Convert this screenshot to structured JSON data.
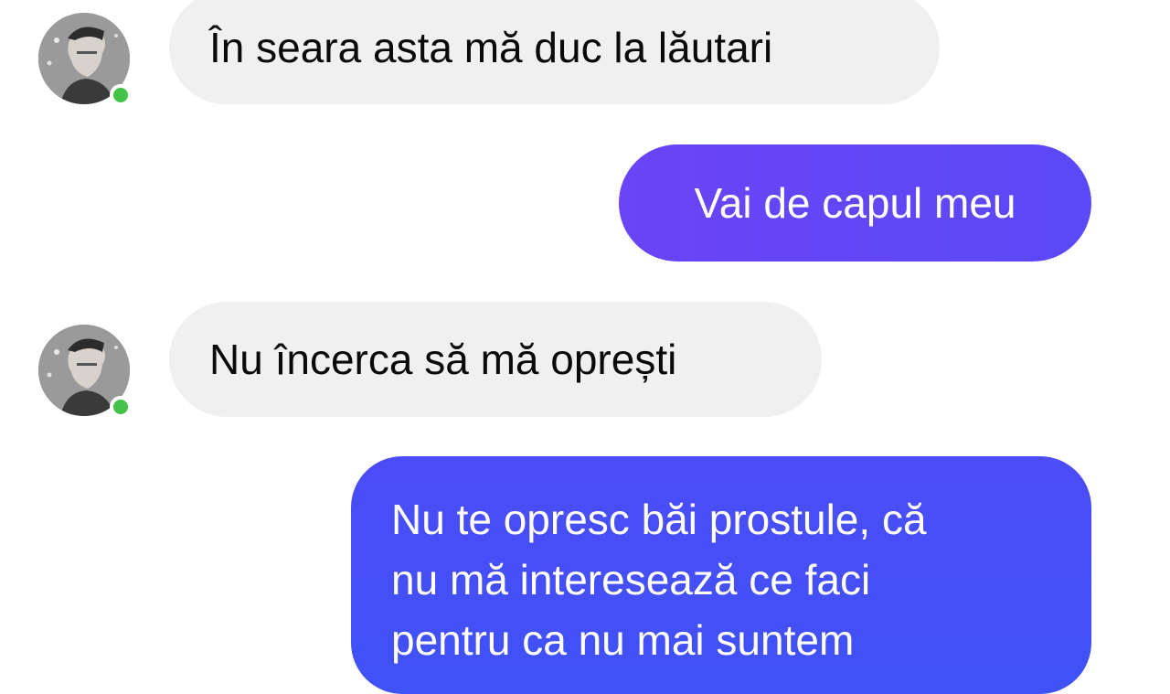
{
  "conversation": {
    "colors": {
      "incoming_bg": "#f0f0f0",
      "incoming_text": "#0a0a0a",
      "outgoing_start": "#7a38f5",
      "outgoing_end": "#4c4cf6",
      "online_dot": "#44c24a"
    },
    "messages": [
      {
        "direction": "incoming",
        "text": "În seara asta mă duc la lăutari"
      },
      {
        "direction": "outgoing",
        "text": "Vai de capul meu"
      },
      {
        "direction": "incoming",
        "text": "Nu încerca să mă oprești"
      },
      {
        "direction": "outgoing",
        "lines": [
          "Nu te opresc băi prostule, că",
          "nu mă interesează ce faci",
          "pentru ca nu mai suntem"
        ]
      }
    ]
  }
}
